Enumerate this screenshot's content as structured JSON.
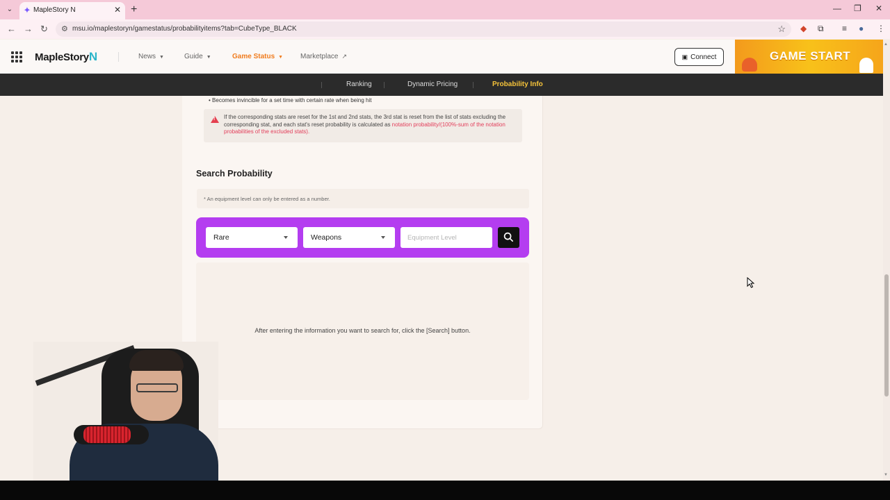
{
  "browser": {
    "tab_title": "MapleStory N",
    "url": "msu.io/maplestoryn/gamestatus/probabilityitems?tab=CubeType_BLACK"
  },
  "header": {
    "logo_text": "MapleStory",
    "logo_suffix": "N",
    "nav": [
      {
        "label": "News"
      },
      {
        "label": "Guide"
      },
      {
        "label": "Game Status"
      },
      {
        "label": "Marketplace"
      }
    ],
    "connect_label": "Connect",
    "game_start_label": "GAME START"
  },
  "subnav": {
    "items": [
      {
        "label": "Ranking"
      },
      {
        "label": "Dynamic Pricing"
      },
      {
        "label": "Probability Info"
      }
    ]
  },
  "content": {
    "bullet_text": "Becomes invincible for a set time with certain rate when being hit",
    "note_text_a": "If the corresponding stats are reset for the 1st and 2nd stats, the 3rd stat is reset from the list of stats excluding the corresponding stat, and each stat's reset probability is calculated as ",
    "note_text_red": "notation probability/(100%-sum of the notation probabilities of the excluded stats)",
    "note_text_end": ".",
    "section_title": "Search Probability",
    "hint": "* An equipment level can only be entered as a number.",
    "search": {
      "grade_value": "Rare",
      "type_value": "Weapons",
      "level_placeholder": "Equipment Level"
    },
    "result_message": "After entering the information you want to search for, click the [Search] button."
  },
  "colors": {
    "accent_orange": "#f07c1e",
    "subnav_active": "#f6c33a",
    "search_bar": "#b43df0",
    "warning_red": "#e23d5a"
  }
}
